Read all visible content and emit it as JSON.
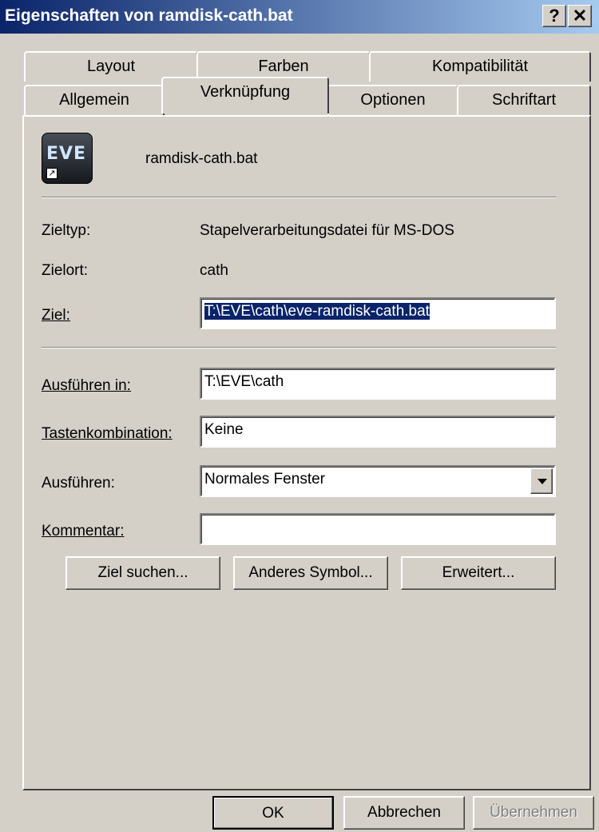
{
  "window": {
    "title": "Eigenschaften von ramdisk-cath.bat",
    "help_label": "?",
    "close_label": "✕"
  },
  "tabs_back": [
    {
      "label": "Layout"
    },
    {
      "label": "Farben"
    },
    {
      "label": "Kompatibilität"
    }
  ],
  "tabs_front": [
    {
      "label": "Allgemein"
    },
    {
      "label": "Verknüpfung",
      "active": true
    },
    {
      "label": "Optionen"
    },
    {
      "label": "Schriftart"
    }
  ],
  "file": {
    "name": "ramdisk-cath.bat",
    "icon": "eve-shortcut-icon",
    "icon_text": "EVE"
  },
  "fields": {
    "zieltyp_label": "Zieltyp:",
    "zieltyp_value": "Stapelverarbeitungsdatei für MS-DOS",
    "zielort_label": "Zielort:",
    "zielort_value": "cath",
    "ziel_label": "Ziel:",
    "ziel_value": "T:\\EVE\\cath\\eve-ramdisk-cath.bat",
    "ausfuehren_in_label": "Ausführen in:",
    "ausfuehren_in_value": "T:\\EVE\\cath",
    "tastenkombination_label": "Tastenkombination:",
    "tastenkombination_value": "Keine",
    "ausfuehren_label": "Ausführen:",
    "ausfuehren_value": "Normales Fenster",
    "kommentar_label": "Kommentar:",
    "kommentar_value": ""
  },
  "buttons": {
    "ziel_suchen": "Ziel suchen...",
    "anderes_symbol": "Anderes Symbol...",
    "erweitert": "Erweitert...",
    "ok": "OK",
    "abbrechen": "Abbrechen",
    "uebernehmen": "Übernehmen"
  },
  "colors": {
    "titlebar_start": "#0a246a",
    "titlebar_end": "#a6caf0",
    "dialog_bg": "#d4d0c8",
    "selection": "#0a246a"
  }
}
